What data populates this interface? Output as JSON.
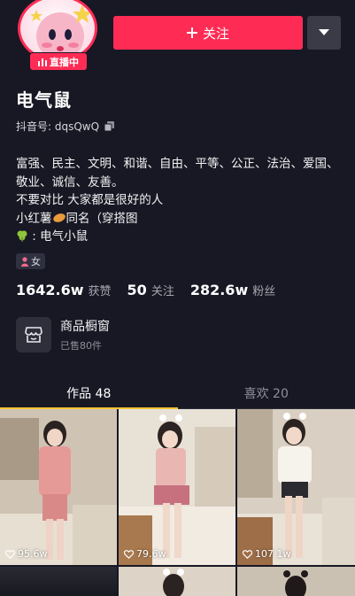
{
  "profile": {
    "live_label": "直播中",
    "name": "电气鼠",
    "douyin_id": "抖音号: dqsQwQ",
    "bio": [
      "富强、民主、文明、和谐、自由、平等、公正、法治、爱国、敬业、诚信、友善。",
      "不要对比 大家都是很好的人",
      "小红薯 同名（穿搭图",
      ": 电气小鼠"
    ],
    "gender": "女"
  },
  "actions": {
    "follow_label": "关注",
    "follow_icon": "plus-icon",
    "more_icon": "caret-down-icon"
  },
  "stats": [
    {
      "value": "1642.6w",
      "label": "获赞"
    },
    {
      "value": "50",
      "label": "关注"
    },
    {
      "value": "282.6w",
      "label": "粉丝"
    }
  ],
  "shop": {
    "title": "商品橱窗",
    "subtitle": "已售80件"
  },
  "tabs": [
    {
      "label": "作品 48",
      "active": true
    },
    {
      "label": "喜欢 20",
      "active": false
    }
  ],
  "videos": [
    {
      "likes": "95.6w"
    },
    {
      "likes": "79.6w"
    },
    {
      "likes": "107.1w"
    }
  ],
  "colors": {
    "background": "#171824",
    "accent": "#fe2c55",
    "tab_indicator": "#f6c531"
  }
}
